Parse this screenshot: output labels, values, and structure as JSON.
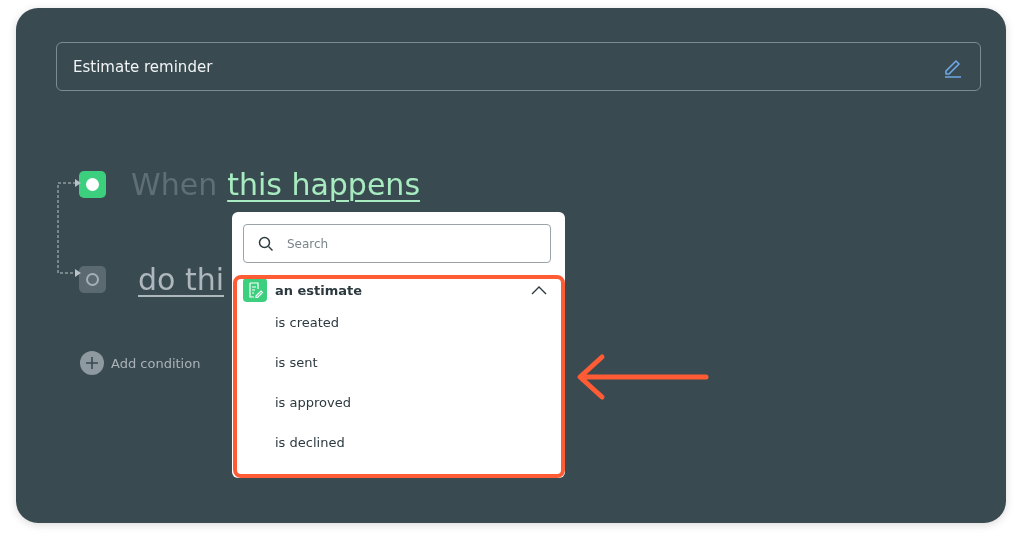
{
  "title_field": {
    "value": "Estimate reminder"
  },
  "steps": [
    {
      "kind": "trigger",
      "active": true,
      "prefix": "When",
      "link": "this happens"
    },
    {
      "kind": "action",
      "active": false,
      "link": "do thi"
    }
  ],
  "add_condition": {
    "label": "Add condition"
  },
  "dropdown": {
    "search": {
      "placeholder": "Search"
    },
    "group": {
      "label": "an estimate",
      "expanded": true,
      "options": [
        "is created",
        "is sent",
        "is approved",
        "is declined"
      ]
    }
  },
  "annotation": {
    "color": "#ff5b35"
  }
}
